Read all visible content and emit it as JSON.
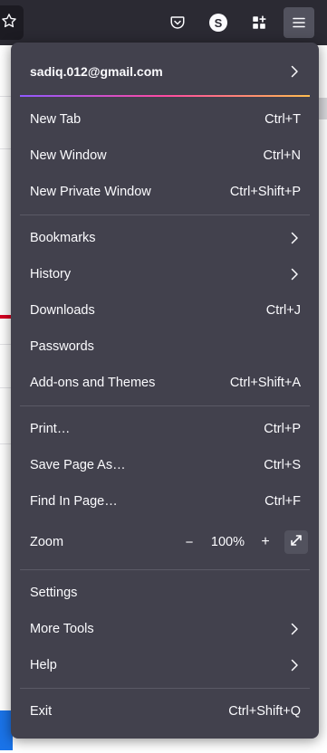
{
  "toolbar": {
    "icons": [
      "star-icon",
      "pocket-icon",
      "sync-account-icon",
      "extensions-icon",
      "hamburger-menu-icon"
    ],
    "account_avatar_letter": "S"
  },
  "menu": {
    "account": {
      "email": "sadiq.012@gmail.com"
    },
    "new_tab": {
      "label": "New Tab",
      "shortcut": "Ctrl+T"
    },
    "new_window": {
      "label": "New Window",
      "shortcut": "Ctrl+N"
    },
    "new_private_window": {
      "label": "New Private Window",
      "shortcut": "Ctrl+Shift+P"
    },
    "bookmarks": {
      "label": "Bookmarks"
    },
    "history": {
      "label": "History"
    },
    "downloads": {
      "label": "Downloads",
      "shortcut": "Ctrl+J"
    },
    "passwords": {
      "label": "Passwords"
    },
    "addons": {
      "label": "Add-ons and Themes",
      "shortcut": "Ctrl+Shift+A"
    },
    "print": {
      "label": "Print…",
      "shortcut": "Ctrl+P"
    },
    "save_page": {
      "label": "Save Page As…",
      "shortcut": "Ctrl+S"
    },
    "find": {
      "label": "Find In Page…",
      "shortcut": "Ctrl+F"
    },
    "zoom": {
      "label": "Zoom",
      "minus": "−",
      "value": "100%",
      "plus": "+"
    },
    "settings": {
      "label": "Settings"
    },
    "more_tools": {
      "label": "More Tools"
    },
    "help": {
      "label": "Help"
    },
    "exit": {
      "label": "Exit",
      "shortcut": "Ctrl+Shift+Q"
    }
  },
  "colors": {
    "toolbar_bg": "#2b2a33",
    "menu_bg": "#42414d",
    "text": "#fbfbfe",
    "separator": "#5b5a66"
  }
}
